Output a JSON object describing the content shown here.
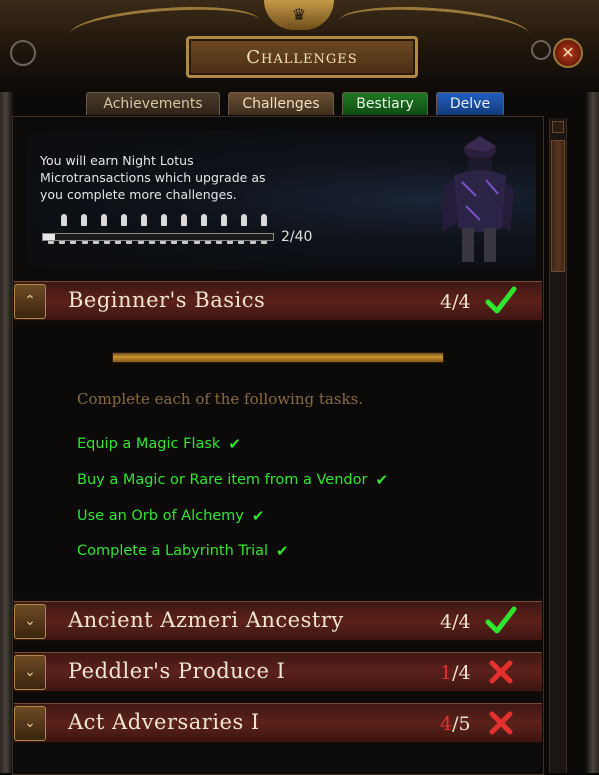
{
  "window": {
    "title": "Challenges",
    "close_icon": "close-icon"
  },
  "tabs": [
    {
      "label": "Achievements",
      "color": "#4a3a2a"
    },
    {
      "label": "Challenges",
      "color": "#6a5034"
    },
    {
      "label": "Bestiary",
      "color": "#1f7a24"
    },
    {
      "label": "Delve",
      "color": "#1f5ec2"
    }
  ],
  "banner": {
    "text": "You will earn Night Lotus Microtransactions which upgrade as you complete more challenges.",
    "progress_text": "2/40",
    "progress": 0.05
  },
  "challenges": [
    {
      "title": "Beginner's Basics",
      "count_done": "4",
      "count_total": "/4",
      "complete": true,
      "expanded": true,
      "instructions": "Complete each of the following tasks.",
      "tasks": [
        "Equip a Magic Flask",
        "Buy a Magic or Rare item from a Vendor",
        "Use an Orb of Alchemy",
        "Complete a Labyrinth Trial"
      ]
    },
    {
      "title": "Ancient Azmeri Ancestry",
      "count_done": "4",
      "count_total": "/4",
      "complete": true
    },
    {
      "title": "Peddler's Produce I",
      "count_done": "1",
      "count_total": "/4",
      "complete": false
    },
    {
      "title": "Act Adversaries I",
      "count_done": "4",
      "count_total": "/5",
      "complete": false
    }
  ],
  "colors": {
    "complete": "#2ee62e",
    "incomplete": "#e53030",
    "accent_gold": "#b08a45"
  }
}
